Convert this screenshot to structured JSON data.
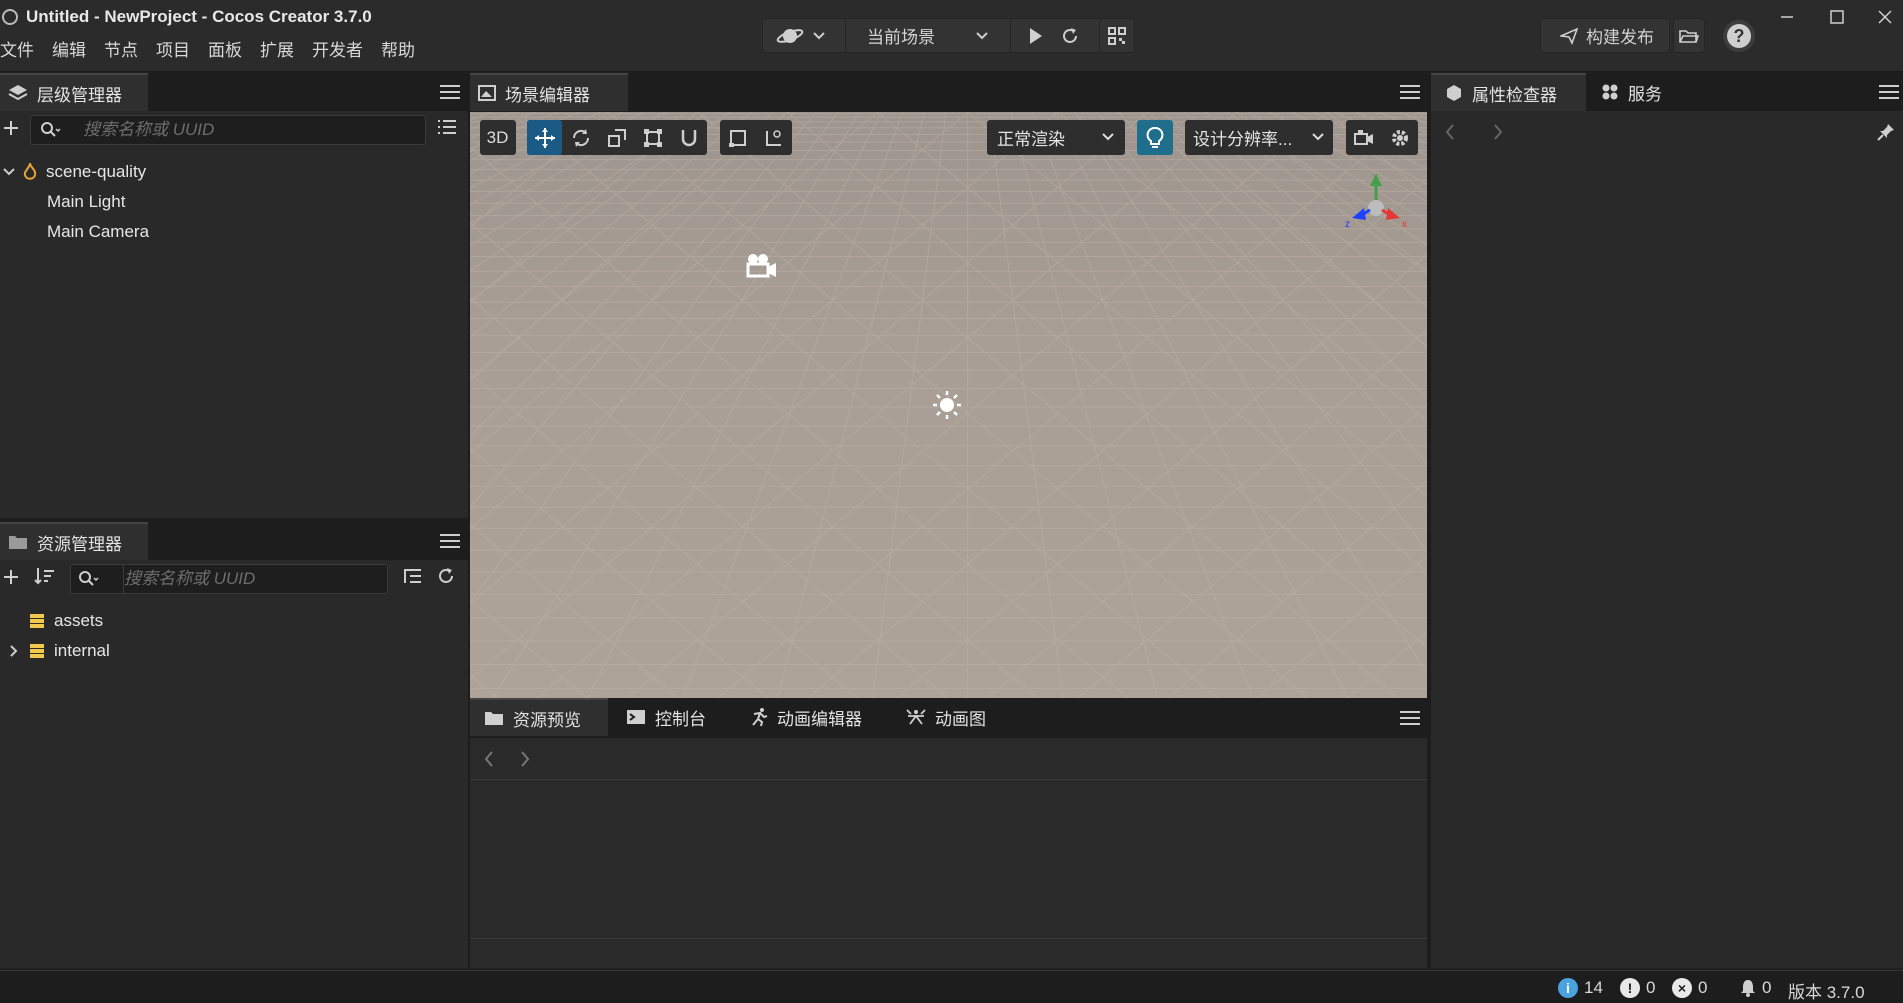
{
  "window": {
    "title": "Untitled - NewProject - Cocos Creator 3.7.0"
  },
  "menu": [
    "文件",
    "编辑",
    "节点",
    "项目",
    "面板",
    "扩展",
    "开发者",
    "帮助"
  ],
  "toolbar": {
    "scene_select_label": "当前场景",
    "build_publish_label": "构建发布"
  },
  "hierarchy": {
    "tab_label": "层级管理器",
    "search_placeholder": "搜索名称或 UUID",
    "nodes": [
      {
        "label": "scene-quality",
        "icon": "scene-fire-icon",
        "expanded": true
      },
      {
        "label": "Main Light"
      },
      {
        "label": "Main Camera"
      }
    ]
  },
  "assets": {
    "tab_label": "资源管理器",
    "search_placeholder": "搜索名称或 UUID",
    "items": [
      {
        "label": "assets",
        "icon": "database-icon"
      },
      {
        "label": "internal",
        "icon": "database-icon",
        "collapsed": true
      }
    ]
  },
  "scene_editor": {
    "tab_label": "场景编辑器",
    "mode_3d": "3D",
    "render_mode": "正常渲染",
    "design_resolution": "设计分辨率...",
    "gizmo_axes": {
      "x": "x",
      "y": "y",
      "z": "z"
    },
    "colors": {
      "x": "#e53935",
      "y": "#43a047",
      "z": "#1e40ff",
      "active_tool": "#1c5a86",
      "light_btn": "#1f6e8c"
    }
  },
  "bottom_panel": {
    "tabs": [
      "资源预览",
      "控制台",
      "动画编辑器",
      "动画图"
    ]
  },
  "inspector": {
    "tabs": [
      "属性检查器",
      "服务"
    ]
  },
  "status": {
    "info_count": "14",
    "warning_count": "0",
    "error_count": "0",
    "notification_count": "0",
    "version": "版本 3.7.0"
  }
}
